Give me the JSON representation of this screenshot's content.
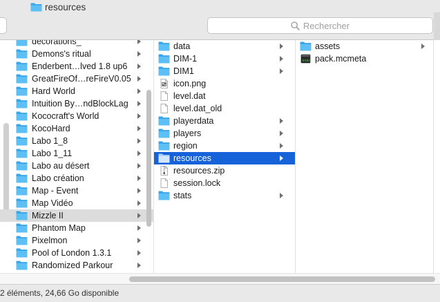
{
  "window": {
    "title": "resources"
  },
  "search": {
    "placeholder": "Rechercher"
  },
  "columns": {
    "col1": {
      "items": [
        {
          "label": "decorations_",
          "type": "folder"
        },
        {
          "label": "Demons's ritual",
          "type": "folder"
        },
        {
          "label": "Enderbent…lved 1.8 up6",
          "type": "folder"
        },
        {
          "label": "GreatFireOf…reFireV0.05",
          "type": "folder"
        },
        {
          "label": "Hard World",
          "type": "folder"
        },
        {
          "label": "Intuition By…ndBlockLag",
          "type": "folder"
        },
        {
          "label": "Kococraft's World",
          "type": "folder"
        },
        {
          "label": "KocoHard",
          "type": "folder"
        },
        {
          "label": "Labo 1_8",
          "type": "folder"
        },
        {
          "label": "Labo 1_11",
          "type": "folder"
        },
        {
          "label": "Labo au désert",
          "type": "folder"
        },
        {
          "label": "Labo création",
          "type": "folder"
        },
        {
          "label": "Map - Event",
          "type": "folder"
        },
        {
          "label": "Map Vidéo",
          "type": "folder"
        },
        {
          "label": "Mizzle II",
          "type": "folder",
          "selected": true
        },
        {
          "label": "Phantom Map",
          "type": "folder"
        },
        {
          "label": "Pixelmon",
          "type": "folder"
        },
        {
          "label": "Pool of London 1.3.1",
          "type": "folder"
        },
        {
          "label": "Randomized Parkour",
          "type": "folder"
        }
      ]
    },
    "col2": {
      "items": [
        {
          "label": "data",
          "type": "folder"
        },
        {
          "label": "DIM-1",
          "type": "folder"
        },
        {
          "label": "DIM1",
          "type": "folder"
        },
        {
          "label": "icon.png",
          "type": "image"
        },
        {
          "label": "level.dat",
          "type": "file"
        },
        {
          "label": "level.dat_old",
          "type": "file"
        },
        {
          "label": "playerdata",
          "type": "folder"
        },
        {
          "label": "players",
          "type": "folder"
        },
        {
          "label": "region",
          "type": "folder"
        },
        {
          "label": "resources",
          "type": "folder",
          "selected": true
        },
        {
          "label": "resources.zip",
          "type": "zip"
        },
        {
          "label": "session.lock",
          "type": "file"
        },
        {
          "label": "stats",
          "type": "folder"
        }
      ]
    },
    "col3": {
      "items": [
        {
          "label": "assets",
          "type": "folder"
        },
        {
          "label": "pack.mcmeta",
          "type": "exec"
        }
      ]
    }
  },
  "status": {
    "text": "2 éléments, 24,66 Go disponible"
  },
  "colors": {
    "folder": "#5ebff5",
    "folder_dark": "#3aa5e8",
    "selection": "#1662d9",
    "inactive_selection": "#dcdcdc"
  }
}
